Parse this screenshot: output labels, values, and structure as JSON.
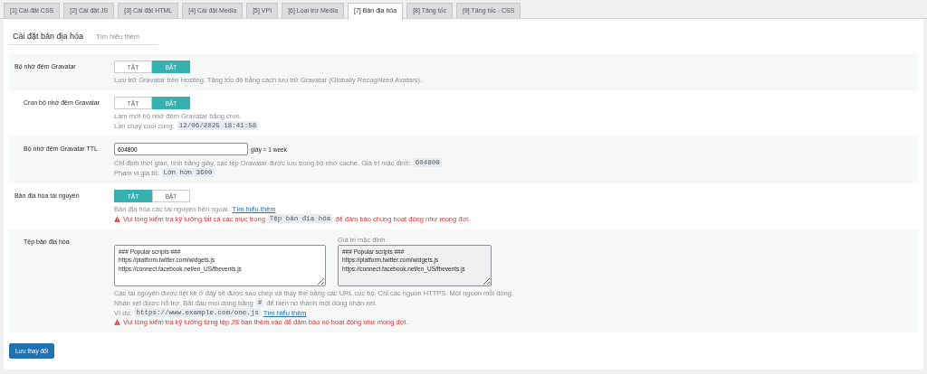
{
  "tabs": [
    {
      "label": "[1] Cài đặt CSS",
      "selected": false
    },
    {
      "label": "[2] Cài đặt JS",
      "selected": false
    },
    {
      "label": "[3] Cài đặt HTML",
      "selected": false
    },
    {
      "label": "[4] Cài đặt Media",
      "selected": false
    },
    {
      "label": "[5] VPI",
      "selected": false
    },
    {
      "label": "[6] Loại trừ Media",
      "selected": false
    },
    {
      "label": "[7] Bản địa hóa",
      "selected": true
    },
    {
      "label": "[8] Tăng tốc",
      "selected": false
    },
    {
      "label": "[9] Tăng tốc - CSS",
      "selected": false
    }
  ],
  "heading": {
    "title": "Cài đặt bản địa hóa",
    "link": "Tìm hiểu thêm"
  },
  "rows": [
    {
      "kind": "toggle",
      "label": "Bộ nhớ đệm Gravatar",
      "indented": false,
      "options": [
        {
          "label": "TẮT",
          "selected": false
        },
        {
          "label": "BẬT",
          "selected": true
        }
      ],
      "lines": [
        {
          "warning": false,
          "parts": [
            {
              "kind": "text",
              "text": "Lưu trữ Gravatar trên Hosting. Tăng tốc độ bằng cách lưu trữ Gravatar (Globally Recognized Avatars)."
            }
          ]
        }
      ]
    },
    {
      "kind": "toggle",
      "label": "Cron bộ nhớ đệm Gravatar",
      "indented": true,
      "options": [
        {
          "label": "TẮT",
          "selected": false
        },
        {
          "label": "BẬT",
          "selected": true
        }
      ],
      "lines": [
        {
          "warning": false,
          "parts": [
            {
              "kind": "text",
              "text": "Làm mới bộ nhớ đệm Gravatar bằng cron."
            }
          ]
        },
        {
          "warning": false,
          "parts": [
            {
              "kind": "text",
              "text": "Lần chạy cuối cùng:"
            },
            {
              "kind": "code",
              "text": "12/06/2025 18:41:58"
            }
          ]
        }
      ]
    },
    {
      "kind": "input",
      "label": "Bộ nhớ đệm Gravatar TTL",
      "indented": true,
      "value": "604800",
      "suffix": "giây = 1 week",
      "lines": [
        {
          "warning": false,
          "parts": [
            {
              "kind": "text",
              "text": "Chỉ định thời gian, tính bằng giây, các tệp Gravatar được lưu trong bộ nhớ cache. Giá trị mặc định:"
            },
            {
              "kind": "code",
              "text": "604800"
            }
          ]
        },
        {
          "warning": false,
          "parts": [
            {
              "kind": "text",
              "text": "Phạm vi giá trị:"
            },
            {
              "kind": "code",
              "text": "Lớn hơn 3600"
            }
          ]
        }
      ]
    },
    {
      "kind": "toggle",
      "label": "Bản địa hóa tài nguyên",
      "indented": false,
      "options": [
        {
          "label": "TẮT",
          "selected": true
        },
        {
          "label": "BẬT",
          "selected": false
        }
      ],
      "lines": [
        {
          "warning": false,
          "parts": [
            {
              "kind": "text",
              "text": "Bản địa hóa các tài nguyên bên ngoài."
            },
            {
              "kind": "link",
              "text": "Tìm hiểu thêm"
            }
          ]
        },
        {
          "warning": true,
          "parts": [
            {
              "kind": "text",
              "text": "Vui lòng kiểm tra kỹ lưỡng tất cả các mục trong"
            },
            {
              "kind": "code",
              "text": "Tệp bản địa hóa"
            },
            {
              "kind": "text",
              "text": "để đảm bảo chúng hoạt động như mong đợi."
            }
          ]
        }
      ]
    },
    {
      "kind": "textarea",
      "label": "Tệp bản địa hóa",
      "indented": true,
      "value": "### Popular scripts ###\nhttps://platform.twitter.com/widgets.js\nhttps://connect.facebook.net/en_US/fbevents.js",
      "default_label": "Giá trị mặc định",
      "default_value": "### Popular scripts ###\nhttps://platform.twitter.com/widgets.js\nhttps://connect.facebook.net/en_US/fbevents.js",
      "lines": [
        {
          "warning": false,
          "parts": [
            {
              "kind": "text",
              "text": "Các tài nguyên được liệt kê ở đây sẽ được sao chép và thay thế bằng các URL cục bộ. Chỉ các nguồn HTTPS. Một nguồn mỗi dòng."
            }
          ]
        },
        {
          "warning": false,
          "parts": [
            {
              "kind": "text",
              "text": "Nhận xét được hỗ trợ. Bắt đầu mọi dòng bằng"
            },
            {
              "kind": "code",
              "text": "#"
            },
            {
              "kind": "text",
              "text": "để biến nó thành một dòng nhận xét."
            }
          ]
        },
        {
          "warning": false,
          "parts": [
            {
              "kind": "text",
              "text": "Ví dụ:"
            },
            {
              "kind": "code",
              "text": "https://www.example.com/one.js"
            },
            {
              "kind": "link",
              "text": "Tìm hiểu thêm"
            }
          ]
        },
        {
          "warning": true,
          "parts": [
            {
              "kind": "text",
              "text": "Vui lòng kiểm tra kỹ lưỡng từng tệp JS bạn thêm vào để đảm bảo nó hoạt động như mong đợi."
            }
          ]
        }
      ]
    }
  ],
  "save_button": "Lưu thay đổi"
}
